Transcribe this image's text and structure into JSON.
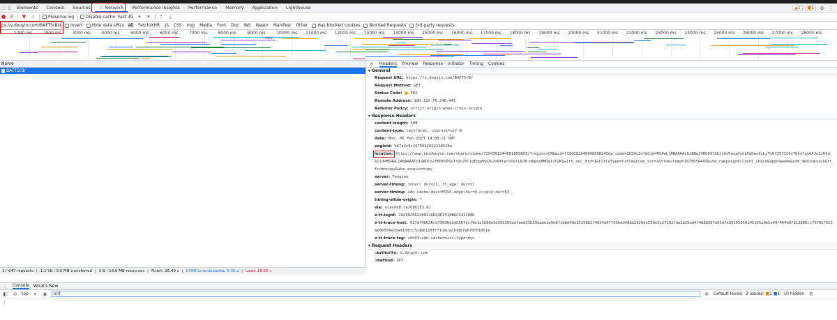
{
  "tabs": [
    "Elements",
    "Console",
    "Sources",
    "Network",
    "Performance insights",
    "Performance",
    "Memory",
    "Application",
    "Lighthouse"
  ],
  "active_tab": "Network",
  "badges": {
    "warnings": "1",
    "issues": "1"
  },
  "toolbar": {
    "preserve_log": "Preserve log",
    "disable_cache": "Disable cache",
    "throttle": "Fast 3G"
  },
  "filter": {
    "value": "ps://v.douyin.com/BAFT5rB/",
    "invert": "Invert",
    "hide_data_urls": "Hide data URLs",
    "types": [
      "All",
      "Fetch/XHR",
      "JS",
      "CSS",
      "Img",
      "Media",
      "Font",
      "Doc",
      "WS",
      "Wasm",
      "Manifest",
      "Other"
    ],
    "selected_type": "All",
    "has_blocked_cookies": "Has blocked cookies",
    "blocked_requests": "Blocked Requests",
    "third_party": "3rd-party requests"
  },
  "timeline": {
    "ticks_top": [
      "1000 ms",
      "2000 ms",
      "3000 ms",
      "4000 ms",
      "5000 ms",
      "6000 ms",
      "7000 ms",
      "8000 ms",
      "9000 ms",
      "10000 ms",
      "11000 ms",
      "12000 ms",
      "13000 ms",
      "14000 ms",
      "15000 ms",
      "16000 ms",
      "17000 ms",
      "18000 ms",
      "19000 ms",
      "20000 ms",
      "21000 ms",
      "22000 ms",
      "23000 ms",
      "24000 ms",
      "25000 ms",
      "26000 ms",
      "27000 ms",
      "28000 ms"
    ]
  },
  "requests": {
    "column": "Name",
    "rows": [
      "BAFT5rB/"
    ]
  },
  "status_bar": {
    "requests": "1 / 647 requests",
    "transferred": "1.1 kB / 3.6 MB transferred",
    "resources": "0 B / 18.0 MB resources",
    "finish": "Finish: 26.49 s",
    "dcl": "DOMContentLoaded: 6.36 s",
    "load": "Load: 18.00 s"
  },
  "detail_tabs": [
    "Headers",
    "Preview",
    "Response",
    "Initiator",
    "Timing",
    "Cookies"
  ],
  "general": {
    "title": "General",
    "rows": [
      {
        "k": "Request URL:",
        "v": "https://v.douyin.com/BAFT5rB/"
      },
      {
        "k": "Request Method:",
        "v": "GET"
      },
      {
        "k": "Status Code:",
        "v": "302"
      },
      {
        "k": "Remote Address:",
        "v": "180.122.76.240:443"
      },
      {
        "k": "Referrer Policy:",
        "v": "strict-origin-when-cross-origin"
      }
    ]
  },
  "response_headers": {
    "title": "Response Headers",
    "rows": [
      {
        "k": "content-length:",
        "v": "488"
      },
      {
        "k": "content-type:",
        "v": "text/html; charset=utf-8"
      },
      {
        "k": "date:",
        "v": "Mon, 06 Feb 2023 14:00:21 GMT"
      },
      {
        "k": "eagleid:",
        "v": "b47a4c9c1675692022218528e"
      },
      {
        "k": "location:",
        "v": "https://www.iesdouyin.com/share/video/7194391244001855803/?region=CN&mid=7194392840990098243&u_code=2h54c2ef&did=MS4wLjABAAAAx5z8NqJVHQ99l0bzjOvPayaXykpVuDwc9iLyTyUY25fIC0v7Dhy7uyGAJn3iUkd_&iid=MS4wLjABAAAAToIGROCtxfB0YO9SxTrQc20llgEogdhp7wJoP4tprsDVlLKJB-d8gqxBMQqiJf2K&with_sec_did=1&titleType=title&from_ssr=1&timestamp=1675654443&utm_campaign=client_share&app=aweme&utm_medium=ios&tt_from=copy&utm_source=copy"
      },
      {
        "k": "server:",
        "v": "Tengine"
      },
      {
        "k": "server-timing:",
        "v": "inner; dur=21, tt_agw; dur=17"
      },
      {
        "k": "server-timing:",
        "v": "cdn-cache;desc=MISS,edge;dur=0,origin;dur=53"
      },
      {
        "k": "timing-allow-origin:",
        "v": "*"
      },
      {
        "k": "via:",
        "v": "vcache8.cn2686[53,0]"
      },
      {
        "k": "x-tt-logid:",
        "v": "20230206220021ADA3E2518BAC3431D8D"
      },
      {
        "k": "x-tt-trace-host:",
        "v": "017d74b636ce75036e2d5367ecf0e1a1680e5e99330dea7eed53b39Saae2e9e8f10bd4de3519b82f90b4a67f65bed488a2626de539e3e27102fda2a29ad4f4888397a05dfe30165050145165a9e5a49f464d9fb13886cc7676bf625ae06554ecbad13dcc7cdb6128ff71daca21dd87a670f61d51e"
      },
      {
        "k": "x-tt-trace-tag:",
        "v": "id=03;cdn-cache=miss;type=dyn"
      }
    ]
  },
  "request_headers": {
    "title": "Request Headers",
    "rows": [
      {
        "k": ":authority:",
        "v": "v.douyin.com"
      },
      {
        "k": ":method:",
        "v": "GET"
      }
    ]
  },
  "drawer": {
    "tabs": [
      "Console",
      "What's New"
    ],
    "context": "top",
    "filter_value": "xnf",
    "levels": "Default levels",
    "issues": "2 Issues:",
    "issue_counts": [
      "1",
      "1"
    ],
    "hidden": "10 hidden"
  },
  "colors": {
    "accent": "#1a73e8",
    "highlight": "#dd0000",
    "warning": "#e37400"
  }
}
